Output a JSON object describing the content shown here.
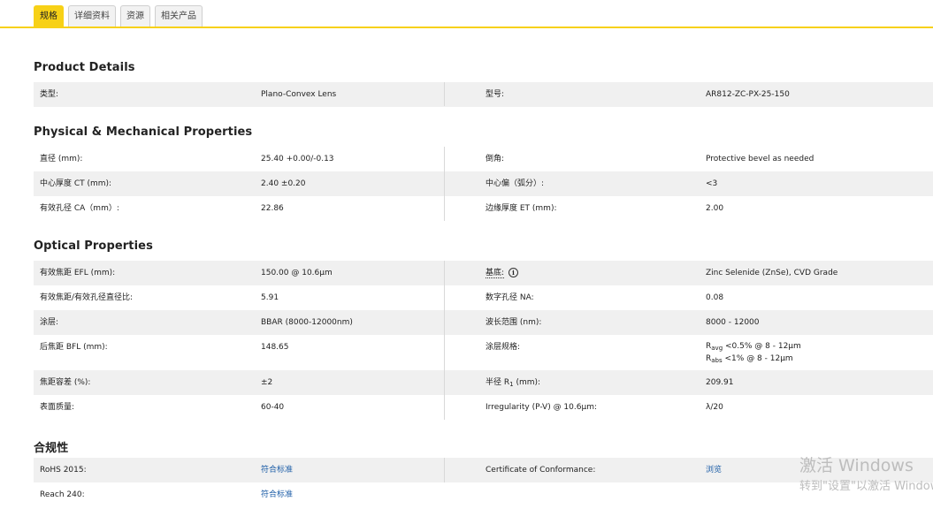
{
  "tabs": [
    {
      "label": "规格",
      "active": true
    },
    {
      "label": "详细资料"
    },
    {
      "label": "资源"
    },
    {
      "label": "相关产品"
    }
  ],
  "sections": {
    "product_details": {
      "title": "Product Details",
      "rows": [
        {
          "label1": "类型:",
          "value1": "Plano-Convex Lens",
          "label2": "型号:",
          "value2": "AR812-ZC-PX-25-150"
        }
      ]
    },
    "physical": {
      "title": "Physical & Mechanical Properties",
      "rows": [
        {
          "label1": "直径 (mm):",
          "value1": "25.40 +0.00/-0.13",
          "label2": "倒角:",
          "value2": "Protective bevel as needed"
        },
        {
          "label1": "中心厚度 CT (mm):",
          "value1": "2.40 ±0.20",
          "label2": "中心偏（弧分）:",
          "value2": "<3"
        },
        {
          "label1": "有效孔径 CA（mm）:",
          "value1": "22.86",
          "label2": "边缘厚度 ET (mm):",
          "value2": "2.00"
        }
      ]
    },
    "optical": {
      "title": "Optical Properties",
      "rows": [
        {
          "label1": "有效焦距 EFL (mm):",
          "value1": "150.00 @ 10.6μm",
          "label2": "基底:",
          "value2": "Zinc Selenide (ZnSe), CVD Grade"
        },
        {
          "label1": "有效焦距/有效孔径直径比:",
          "value1": "5.91",
          "label2": "数字孔径 NA:",
          "value2": "0.08"
        },
        {
          "label1": "涂层:",
          "value1": "BBAR (8000-12000nm)",
          "label2": "波长范围 (nm):",
          "value2": "8000 - 12000"
        },
        {
          "label1": "后焦距 BFL (mm):",
          "value1": "148.65",
          "label2": "涂层规格:",
          "value2_line1_sub": "avg",
          "value2_line1_rest": " <0.5% @ 8 - 12μm",
          "value2_line2_sub": "abs",
          "value2_line2_rest": " <1% @ 8 - 12μm",
          "value2_prefix": "R"
        },
        {
          "label1": "焦距容差 (%):",
          "value1": "±2",
          "label2_prefix": "半径 R",
          "label2_sub": "1",
          "label2_suffix": " (mm):",
          "value2": "209.91"
        },
        {
          "label1": "表面质量:",
          "value1": "60-40",
          "label2": "Irregularity (P-V) @ 10.6μm:",
          "value2": "λ/20"
        }
      ]
    },
    "compliance": {
      "title": "合规性",
      "rows": [
        {
          "label1": "RoHS 2015:",
          "value1": "符合标准",
          "label2": "Certificate of Conformance:",
          "value2": "浏览"
        },
        {
          "label1": "Reach 240:",
          "value1": "符合标准"
        }
      ]
    }
  },
  "info_icon": {
    "name": "info-icon",
    "glyph": "i"
  },
  "watermark": {
    "line1": "激活 Windows",
    "line2": "转到\"设置\"以激活 Windows。"
  },
  "colors": {
    "accent": "#f7d117",
    "row_shade": "#f0f0f0",
    "link": "#1f5fa8"
  }
}
